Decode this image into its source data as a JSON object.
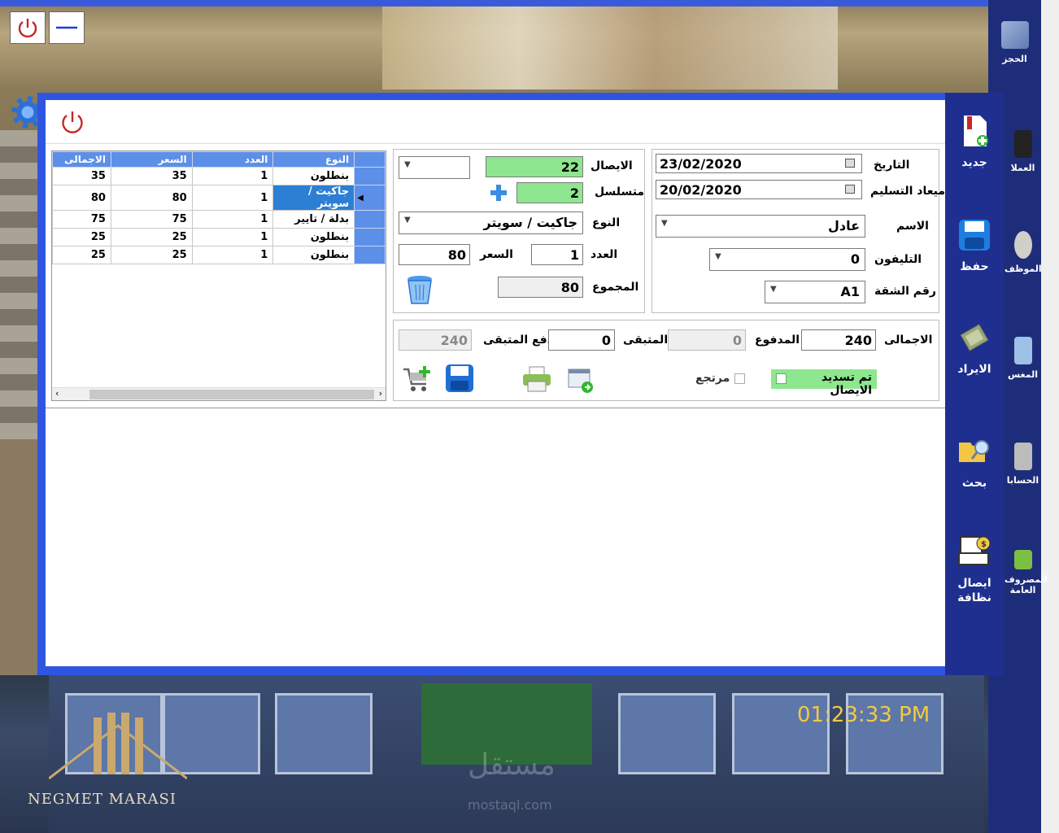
{
  "window": {
    "power_icon": "power-icon",
    "minimize_icon": "minimize-icon"
  },
  "outer_nav": [
    {
      "label": "الحجز",
      "icon": "building-icon"
    },
    {
      "label": "العملا",
      "icon": "customers-icon"
    },
    {
      "label": "الموظف",
      "icon": "employee-icon"
    },
    {
      "label": "المغس",
      "icon": "washer-icon"
    },
    {
      "label": "الحسابا",
      "icon": "dollar-icon"
    },
    {
      "label": "المصروف العامة",
      "icon": "money-icon"
    }
  ],
  "sidebar": {
    "new": "جديد",
    "save": "حفظ",
    "revenue": "الايراد",
    "search": "بحث",
    "cleaning_receipt": "ايصال نظافة"
  },
  "grid": {
    "headers": [
      "النوع",
      "العدد",
      "السعر",
      "الاجمالى"
    ],
    "rows": [
      {
        "type": "بنطلون",
        "qty": "1",
        "price": "35",
        "total": "35",
        "selected": false
      },
      {
        "type": "جاكيت / سويتر",
        "qty": "1",
        "price": "80",
        "total": "80",
        "selected": true
      },
      {
        "type": "بدلة / تايير",
        "qty": "1",
        "price": "75",
        "total": "75",
        "selected": false
      },
      {
        "type": "بنطلون",
        "qty": "1",
        "price": "25",
        "total": "25",
        "selected": false
      },
      {
        "type": "بنطلون",
        "qty": "1",
        "price": "25",
        "total": "25",
        "selected": false
      }
    ]
  },
  "order": {
    "receipt_label": "الايصال",
    "receipt_value": "22",
    "serial_label": "متسلسل",
    "serial_value": "2",
    "type_label": "النوع",
    "type_value": "جاكيت / سويتر",
    "qty_label": "العدد",
    "qty_value": "1",
    "price_label": "السعر",
    "price_value": "80",
    "sum_label": "المجموع",
    "sum_value": "80"
  },
  "customer": {
    "date_label": "التاريخ",
    "date_value": "23/02/2020",
    "delivery_label": "ميعاد التسليم",
    "delivery_value": "20/02/2020",
    "name_label": "الاسم",
    "name_value": "عادل",
    "phone_label": "التليفون",
    "phone_value": "0",
    "apt_label": "رقم الشقة",
    "apt_value": "A1"
  },
  "payment": {
    "total_label": "الاجمالى",
    "total_value": "240",
    "paid_label": "المدفوع",
    "paid_value": "0",
    "remaining_label": "المتبقى",
    "remaining_value": "0",
    "pay_remaining_label": "دفع المتبقى",
    "pay_remaining_value": "240",
    "returned_label": "مرتجع",
    "cleared_label": "تم تسديد الايصال"
  },
  "clock": "01:23:33 PM",
  "brand": "NEGMET MARASI",
  "watermark": "مستقل",
  "watermark_url": "mostaql.com"
}
